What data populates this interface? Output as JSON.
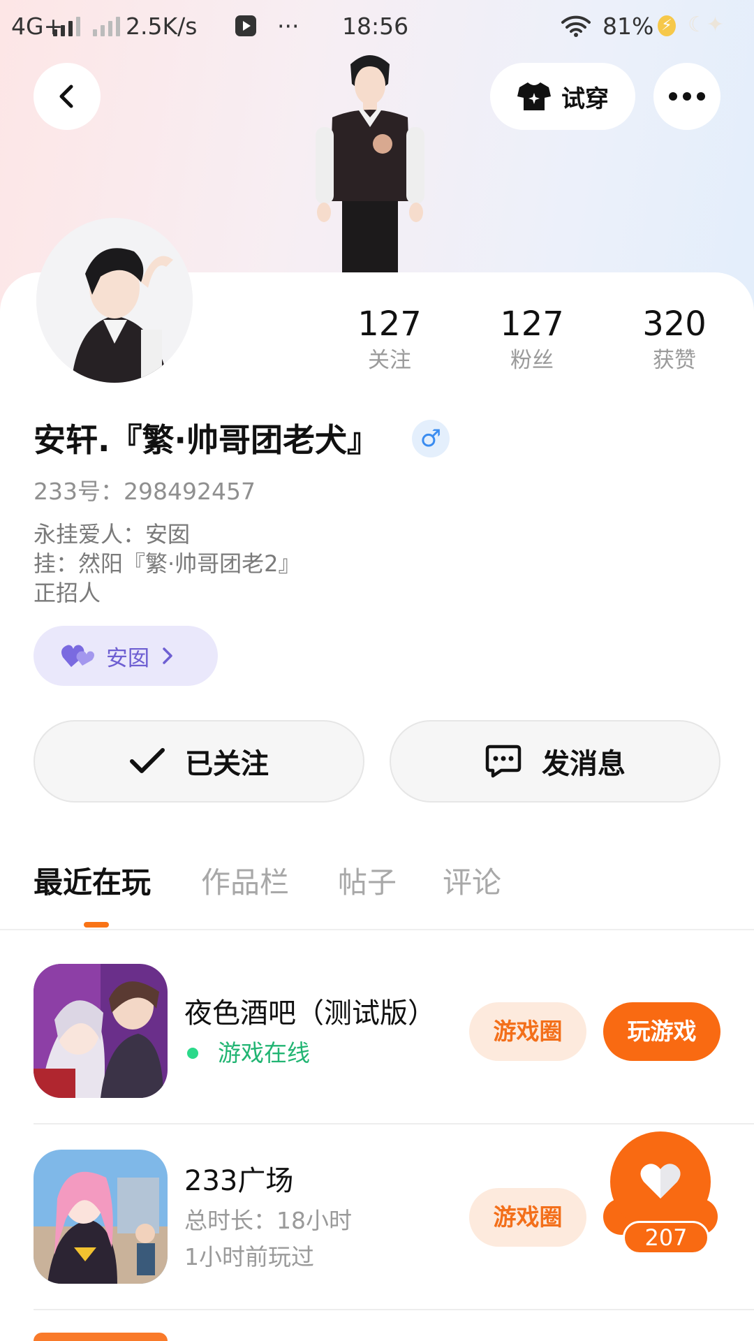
{
  "status_bar": {
    "network": "4G+",
    "speed": "2.5K/s",
    "more": "···",
    "time": "18:56",
    "battery": "81%"
  },
  "header": {
    "back_icon": "chevron-left-icon",
    "tryon_label": "试穿",
    "tryon_icon": "tshirt-icon",
    "more_icon": "more-horizontal-icon"
  },
  "stats": [
    {
      "value": "127",
      "label": "关注"
    },
    {
      "value": "127",
      "label": "粉丝"
    },
    {
      "value": "320",
      "label": "获赞"
    }
  ],
  "profile": {
    "name": "安轩.『繁·帅哥团老犬』",
    "gender_symbol": "♂",
    "uid": "233号：298492457",
    "bio": [
      "永挂爱人：安囡",
      "挂：然阳『繁·帅哥团老2』",
      "正招人"
    ],
    "couple_name": "安囡",
    "couple_icon": "heart-pair-icon"
  },
  "actions": {
    "follow_label": "已关注",
    "message_label": "发消息"
  },
  "tabs": [
    "最近在玩",
    "作品栏",
    "帖子",
    "评论"
  ],
  "games": [
    {
      "title": "夜色酒吧（测试版）",
      "status": "游戏在线",
      "circle_label": "游戏圈",
      "play_label": "玩游戏"
    },
    {
      "title": "233广场",
      "duration": "总时长：18小时",
      "last_played": "1小时前玩过",
      "circle_label": "游戏圈"
    }
  ],
  "like_fab": {
    "count": "207"
  },
  "colors": {
    "accent": "#f96a12",
    "accent_light": "#fdeadd",
    "online": "#22b573",
    "couple_chip": "#eae8fb",
    "couple_text": "#6e5fd2",
    "gender": "#3a8cf0"
  }
}
